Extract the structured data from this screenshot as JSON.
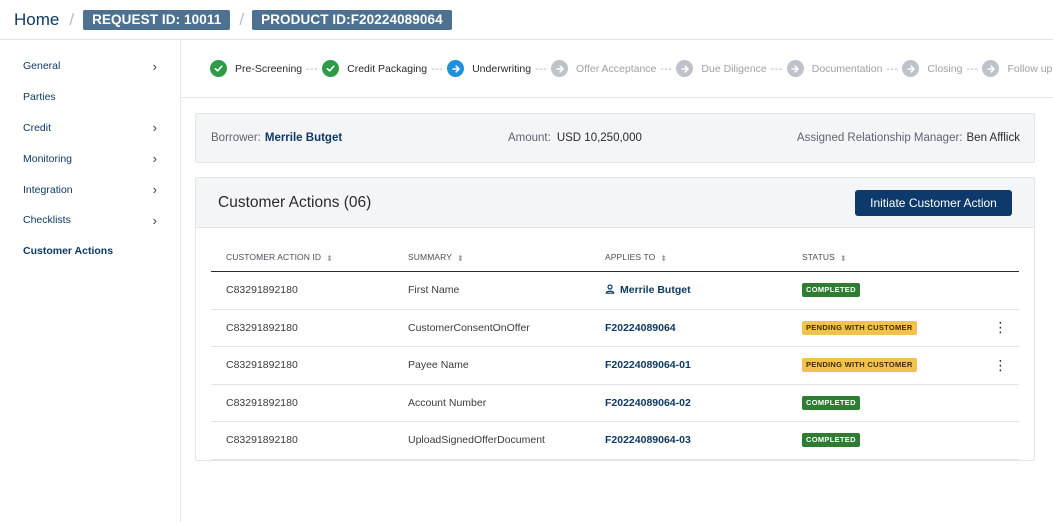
{
  "breadcrumb": {
    "home": "Home",
    "separator": "/",
    "request_id": "REQUEST ID: 10011",
    "product_id": "PRODUCT ID:F20224089064"
  },
  "sidebar": {
    "items": [
      {
        "label": "General",
        "chevron": "›"
      },
      {
        "label": "Parties",
        "chevron": ""
      },
      {
        "label": "Credit",
        "chevron": "›"
      },
      {
        "label": "Monitoring",
        "chevron": "›"
      },
      {
        "label": "Integration",
        "chevron": "›"
      },
      {
        "label": "Checklists",
        "chevron": "›"
      },
      {
        "label": "Customer Actions",
        "chevron": "",
        "active": true
      }
    ]
  },
  "stepper": {
    "dashes": "---",
    "steps": [
      {
        "label": "Pre-Screening",
        "state": "done",
        "icon": "check-icon"
      },
      {
        "label": "Credit Packaging",
        "state": "done",
        "icon": "check-icon"
      },
      {
        "label": "Underwriting",
        "state": "current",
        "icon": "arrow-right-icon"
      },
      {
        "label": "Offer Acceptance",
        "state": "todo",
        "icon": "arrow-right-icon"
      },
      {
        "label": "Due Diligence",
        "state": "todo",
        "icon": "arrow-right-icon"
      },
      {
        "label": "Documentation",
        "state": "todo",
        "icon": "arrow-right-icon"
      },
      {
        "label": "Closing",
        "state": "todo",
        "icon": "arrow-right-icon"
      },
      {
        "label": "Follow up",
        "state": "todo",
        "icon": "arrow-right-icon"
      }
    ]
  },
  "borrower_info": {
    "borrower_label": "Borrower:",
    "borrower_name": "Merrile Butget",
    "amount_label": "Amount:",
    "amount_value": "USD 10,250,000",
    "manager_label": "Assigned Relationship Manager:",
    "manager_name": "Ben Afflick"
  },
  "customer_actions": {
    "title": "Customer Actions (06)",
    "initiate_button": "Initiate Customer Action",
    "columns": [
      "CUSTOMER ACTION ID",
      "SUMMARY",
      "APPLIES TO",
      "STATUS"
    ],
    "rows": [
      {
        "id": "C83291892180",
        "summary": "First Name",
        "applies_to": "Merrile Butget",
        "applies_icon": "person-icon",
        "status": "COMPLETED",
        "status_type": "completed",
        "menu": false
      },
      {
        "id": "C83291892180",
        "summary": "CustomerConsentOnOffer",
        "applies_to": "F20224089064",
        "status": "PENDING WITH CUSTOMER",
        "status_type": "pending",
        "menu": true
      },
      {
        "id": "C83291892180",
        "summary": "Payee Name",
        "applies_to": "F20224089064-01",
        "status": "PENDING WITH CUSTOMER",
        "status_type": "pending",
        "menu": true
      },
      {
        "id": "C83291892180",
        "summary": "Account Number",
        "applies_to": "F20224089064-02",
        "status": "COMPLETED",
        "status_type": "completed",
        "menu": false
      },
      {
        "id": "C83291892180",
        "summary": "UploadSignedOfferDocument",
        "applies_to": "F20224089064-03",
        "status": "COMPLETED",
        "status_type": "completed",
        "menu": false
      }
    ]
  },
  "colors": {
    "primary": "#0e3a6b",
    "chip": "#4f7190",
    "done": "#2e9b46",
    "current": "#1f8fe0",
    "todo": "#bdc3c9",
    "completed_badge": "#2e7d32",
    "pending_badge": "#f3c24c"
  }
}
